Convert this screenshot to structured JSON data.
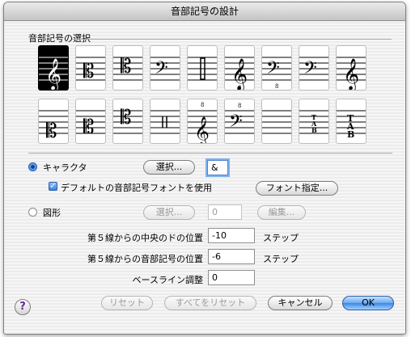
{
  "window": {
    "title": "音部記号の設計"
  },
  "section": {
    "label": "音部記号の選択"
  },
  "clefs": [
    {
      "id": "treble",
      "icon": "treble-clef-icon",
      "selected": true
    },
    {
      "id": "alto",
      "icon": "alto-clef-icon",
      "selected": false
    },
    {
      "id": "tenor",
      "icon": "tenor-clef-icon",
      "selected": false
    },
    {
      "id": "bass",
      "icon": "bass-clef-icon",
      "selected": false
    },
    {
      "id": "percussion",
      "icon": "percussion-clef-icon",
      "selected": false
    },
    {
      "id": "treble-8vb",
      "icon": "treble-8vb-clef-icon",
      "selected": false
    },
    {
      "id": "bass-8vb",
      "icon": "bass-8vb-clef-icon",
      "selected": false
    },
    {
      "id": "bass-plain",
      "icon": "bass-clef-small-icon",
      "selected": false
    },
    {
      "id": "treble-small",
      "icon": "treble-clef-small-icon",
      "selected": false
    },
    {
      "id": "soprano",
      "icon": "soprano-clef-icon",
      "selected": false
    },
    {
      "id": "mezzo",
      "icon": "mezzo-clef-icon",
      "selected": false
    },
    {
      "id": "baritone-c",
      "icon": "baritone-c-clef-icon",
      "selected": false
    },
    {
      "id": "percussion-2",
      "icon": "percussion-clef-2-icon",
      "selected": false
    },
    {
      "id": "treble-8va",
      "icon": "treble-8va-clef-icon",
      "selected": false
    },
    {
      "id": "bass-8va",
      "icon": "bass-8va-clef-icon",
      "selected": false
    },
    {
      "id": "blank",
      "icon": "blank-clef-icon",
      "selected": false
    },
    {
      "id": "tab-small",
      "icon": "tab-clef-small-icon",
      "selected": false
    },
    {
      "id": "tab",
      "icon": "tab-clef-icon",
      "selected": false
    }
  ],
  "character": {
    "label": "キャラクタ",
    "select_button": "選択...",
    "value": "&",
    "default_font_checkbox": "デフォルトの音部記号フォントを使用",
    "font_button": "フォント指定..."
  },
  "shape": {
    "label": "図形",
    "select_button": "選択...",
    "value": "0",
    "edit_button": "編集..."
  },
  "params": {
    "middle_c_label": "第５線からの中央のドの位置",
    "middle_c_value": "-10",
    "clef_pos_label": "第５線からの音部記号の位置",
    "clef_pos_value": "-6",
    "baseline_label": "ベースライン調整",
    "baseline_value": "0",
    "unit": "ステップ"
  },
  "footer": {
    "help": "?",
    "reset": "リセット",
    "reset_all": "すべてをリセット",
    "cancel": "キャンセル",
    "ok": "OK"
  }
}
